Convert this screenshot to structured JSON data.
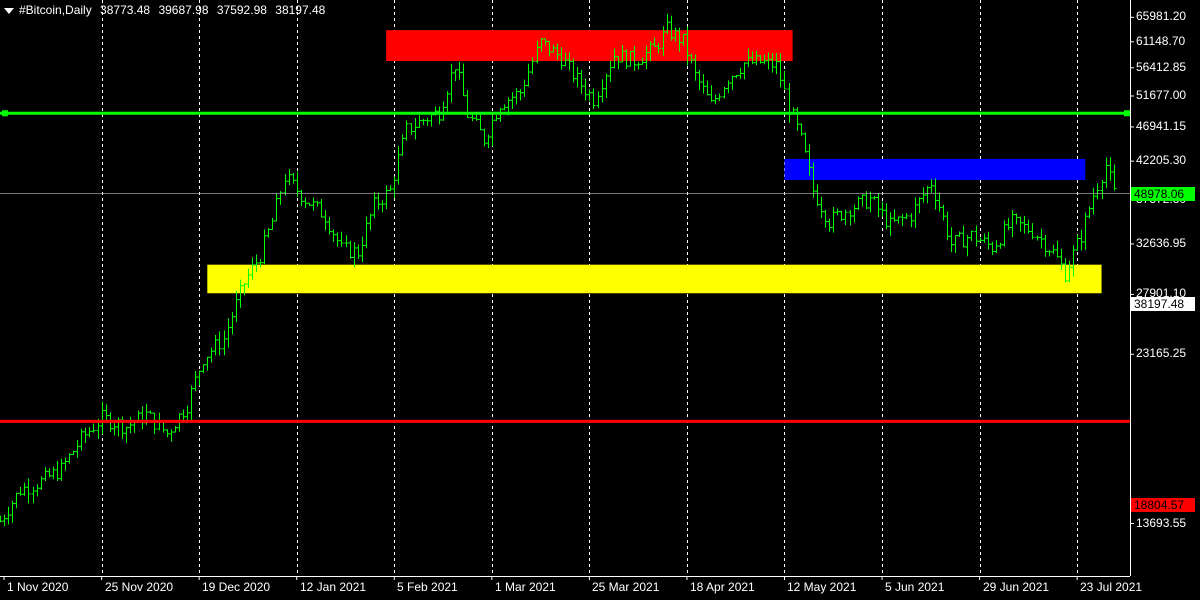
{
  "header": {
    "symbol": "#Bitcoin,Daily",
    "open": "38773.48",
    "high": "39687.98",
    "low": "37592.98",
    "close": "38197.48"
  },
  "price_axis": {
    "labels": [
      "65981.20",
      "61148.70",
      "56412.85",
      "51677.00",
      "46941.15",
      "42205.30",
      "37372.80",
      "32636.95",
      "27901.10",
      "23165.25",
      "13693.55"
    ]
  },
  "time_axis": {
    "labels": [
      "1 Nov 2020",
      "25 Nov 2020",
      "19 Dec 2020",
      "12 Jan 2021",
      "5 Feb 2021",
      "1 Mar 2021",
      "25 Mar 2021",
      "18 Apr 2021",
      "12 May 2021",
      "5 Jun 2021",
      "29 Jun 2021",
      "23 Jul 2021"
    ]
  },
  "lines": {
    "resistance": {
      "price": "48978.06",
      "color": "#00ff00"
    },
    "support": {
      "price": "18804.57",
      "color": "#ff0000"
    },
    "current": {
      "price": "38197.48",
      "color": "#c0c0c0"
    }
  },
  "zones": [
    {
      "name": "red-zone",
      "color": "#ff0000",
      "from_date": "2021-02-03",
      "to_date": "2021-05-14",
      "low": 57600,
      "high": 63400
    },
    {
      "name": "blue-zone",
      "color": "#0000ff",
      "from_date": "2021-05-12",
      "to_date": "2021-07-25",
      "low": 39800,
      "high": 42500
    },
    {
      "name": "yellow-zone",
      "color": "#ffff00",
      "from_date": "2020-12-21",
      "to_date": "2021-07-29",
      "low": 28000,
      "high": 30600
    }
  ],
  "colors": {
    "background": "#000000",
    "candle": "#00ff00",
    "grid": "#ffffff",
    "axis_text": "#ffffff"
  },
  "chart_data": {
    "type": "line",
    "title": "#Bitcoin,Daily",
    "x": [
      "2020-10-31",
      "2020-11-05",
      "2020-11-10",
      "2020-11-15",
      "2020-11-20",
      "2020-11-25",
      "2020-12-01",
      "2020-12-06",
      "2020-12-11",
      "2020-12-16",
      "2020-12-20",
      "2020-12-25",
      "2020-12-30",
      "2021-01-03",
      "2021-01-06",
      "2021-01-09",
      "2021-01-14",
      "2021-01-19",
      "2021-01-23",
      "2021-01-27",
      "2021-01-31",
      "2021-02-04",
      "2021-02-08",
      "2021-02-12",
      "2021-02-16",
      "2021-02-20",
      "2021-02-23",
      "2021-02-27",
      "2021-03-03",
      "2021-03-08",
      "2021-03-13",
      "2021-03-18",
      "2021-03-22",
      "2021-03-26",
      "2021-03-31",
      "2021-04-05",
      "2021-04-10",
      "2021-04-13",
      "2021-04-17",
      "2021-04-20",
      "2021-04-24",
      "2021-04-28",
      "2021-05-02",
      "2021-05-06",
      "2021-05-10",
      "2021-05-13",
      "2021-05-16",
      "2021-05-19",
      "2021-05-23",
      "2021-05-28",
      "2021-06-02",
      "2021-06-07",
      "2021-06-12",
      "2021-06-17",
      "2021-06-22",
      "2021-06-27",
      "2021-07-02",
      "2021-07-07",
      "2021-07-12",
      "2021-07-17",
      "2021-07-20",
      "2021-07-24",
      "2021-07-27",
      "2021-07-30",
      "2021-08-01"
    ],
    "y": [
      13800,
      15200,
      15600,
      16200,
      17800,
      19000,
      18500,
      19200,
      18100,
      19800,
      22900,
      24300,
      28900,
      31500,
      35000,
      40200,
      37500,
      35600,
      32100,
      31800,
      36800,
      38500,
      46500,
      48000,
      49200,
      57000,
      48800,
      45200,
      50500,
      52300,
      61000,
      58200,
      54300,
      51200,
      58700,
      57700,
      59800,
      63500,
      61200,
      55000,
      50200,
      54700,
      57200,
      57400,
      56800,
      50000,
      45000,
      38500,
      35000,
      36500,
      37500,
      34600,
      35700,
      39500,
      32600,
      33500,
      32300,
      34900,
      34000,
      31800,
      29800,
      33500,
      38000,
      41700,
      38197
    ],
    "ylim": [
      12000,
      67500
    ],
    "xlim": [
      "2020-10-31",
      "2021-08-05"
    ],
    "y_scale": "log",
    "grid": true,
    "xlabel": "",
    "ylabel": ""
  }
}
